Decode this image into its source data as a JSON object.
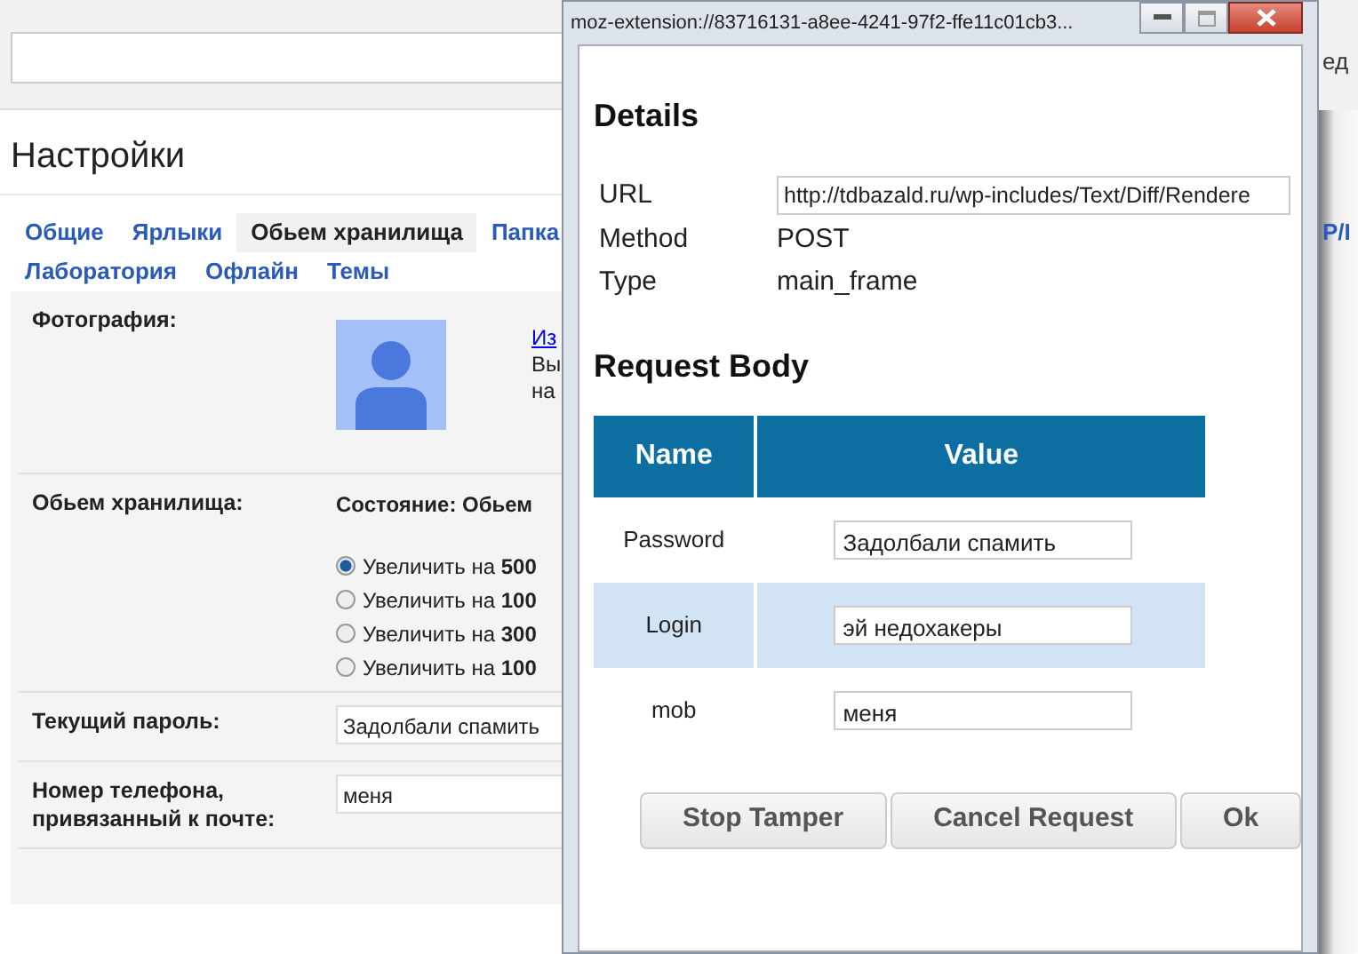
{
  "page": {
    "title": "Настройки",
    "tab_rows": [
      {
        "tabs": [
          {
            "label": "Общие",
            "selected": false
          },
          {
            "label": "Ярлыки",
            "selected": false
          },
          {
            "label": "Обьем хранилища",
            "selected": true
          },
          {
            "label": "Папка",
            "selected": false
          }
        ]
      },
      {
        "tabs": [
          {
            "label": "Лаборатория",
            "selected": false
          },
          {
            "label": "Офлайн",
            "selected": false
          },
          {
            "label": "Темы",
            "selected": false
          }
        ]
      }
    ],
    "settings": [
      {
        "kind": "photo",
        "label": "Фотография:",
        "link": "Из",
        "lines": [
          "Вы",
          "на"
        ]
      },
      {
        "kind": "radios",
        "label": "Обьем хранилища:",
        "status": "Состояние: Обьем",
        "options": [
          {
            "label": "Увеличить на **500**",
            "selected": true
          },
          {
            "label": "Увеличить на **100**",
            "selected": false
          },
          {
            "label": "Увеличить на **300**",
            "selected": false
          },
          {
            "label": "Увеличить на **100**",
            "selected": false
          }
        ]
      },
      {
        "kind": "field",
        "label": "Текущий пароль:",
        "value": "Задолбали спамить"
      },
      {
        "kind": "field",
        "label": "Номер телефона, привязанный к почте:",
        "value": "меня"
      }
    ],
    "edge_texts": [
      {
        "kind": "plain",
        "text": "ед"
      },
      {
        "kind": "tab",
        "text": "P/I"
      }
    ]
  },
  "popup": {
    "title": "moz-extension://83716131-a8ee-4241-97f2-ffe11c01cb3...",
    "heading": "Details",
    "details": [
      {
        "kind": "field",
        "label": "URL",
        "value": "http://tdbazald.ru/wp-includes/Text/Diff/Rendere"
      },
      {
        "kind": "text",
        "label": "Method",
        "value": "POST"
      },
      {
        "kind": "text",
        "label": "Type",
        "value": "main_frame"
      }
    ],
    "body_heading": "Request Body",
    "table": {
      "columns": [
        "Name",
        "Value"
      ],
      "rows": [
        {
          "name": "Password",
          "value": "Задолбали спамить",
          "highlighted": false
        },
        {
          "name": "Login",
          "value": "эй недохакеры",
          "highlighted": true
        },
        {
          "name": "mob",
          "value": "меня",
          "highlighted": false
        }
      ]
    },
    "buttons": [
      "Stop Tamper",
      "Cancel Request",
      "Ok"
    ]
  }
}
